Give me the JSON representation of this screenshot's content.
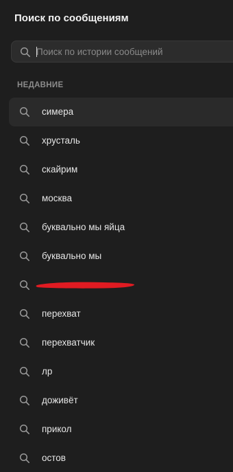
{
  "header": {
    "title": "Поиск по сообщениям"
  },
  "search": {
    "placeholder": "Поиск по истории сообщений",
    "value": ""
  },
  "recent": {
    "section_label": "НЕДАВНИЕ",
    "items": [
      {
        "label": "симера",
        "active": true
      },
      {
        "label": "хрусталь"
      },
      {
        "label": "скайрим"
      },
      {
        "label": "москва"
      },
      {
        "label": "буквально мы яйца"
      },
      {
        "label": "буквально мы"
      },
      {
        "label": "",
        "redacted": true
      },
      {
        "label": "перехват"
      },
      {
        "label": "перехватчик"
      },
      {
        "label": "лр"
      },
      {
        "label": "доживёт"
      },
      {
        "label": "прикол"
      },
      {
        "label": "остов"
      }
    ]
  },
  "icons": {
    "search": "search-icon"
  },
  "colors": {
    "background": "#1e1e1e",
    "search_field": "#2c2c2c",
    "active_row": "#2a2a2a",
    "redaction": "#e01b22"
  }
}
